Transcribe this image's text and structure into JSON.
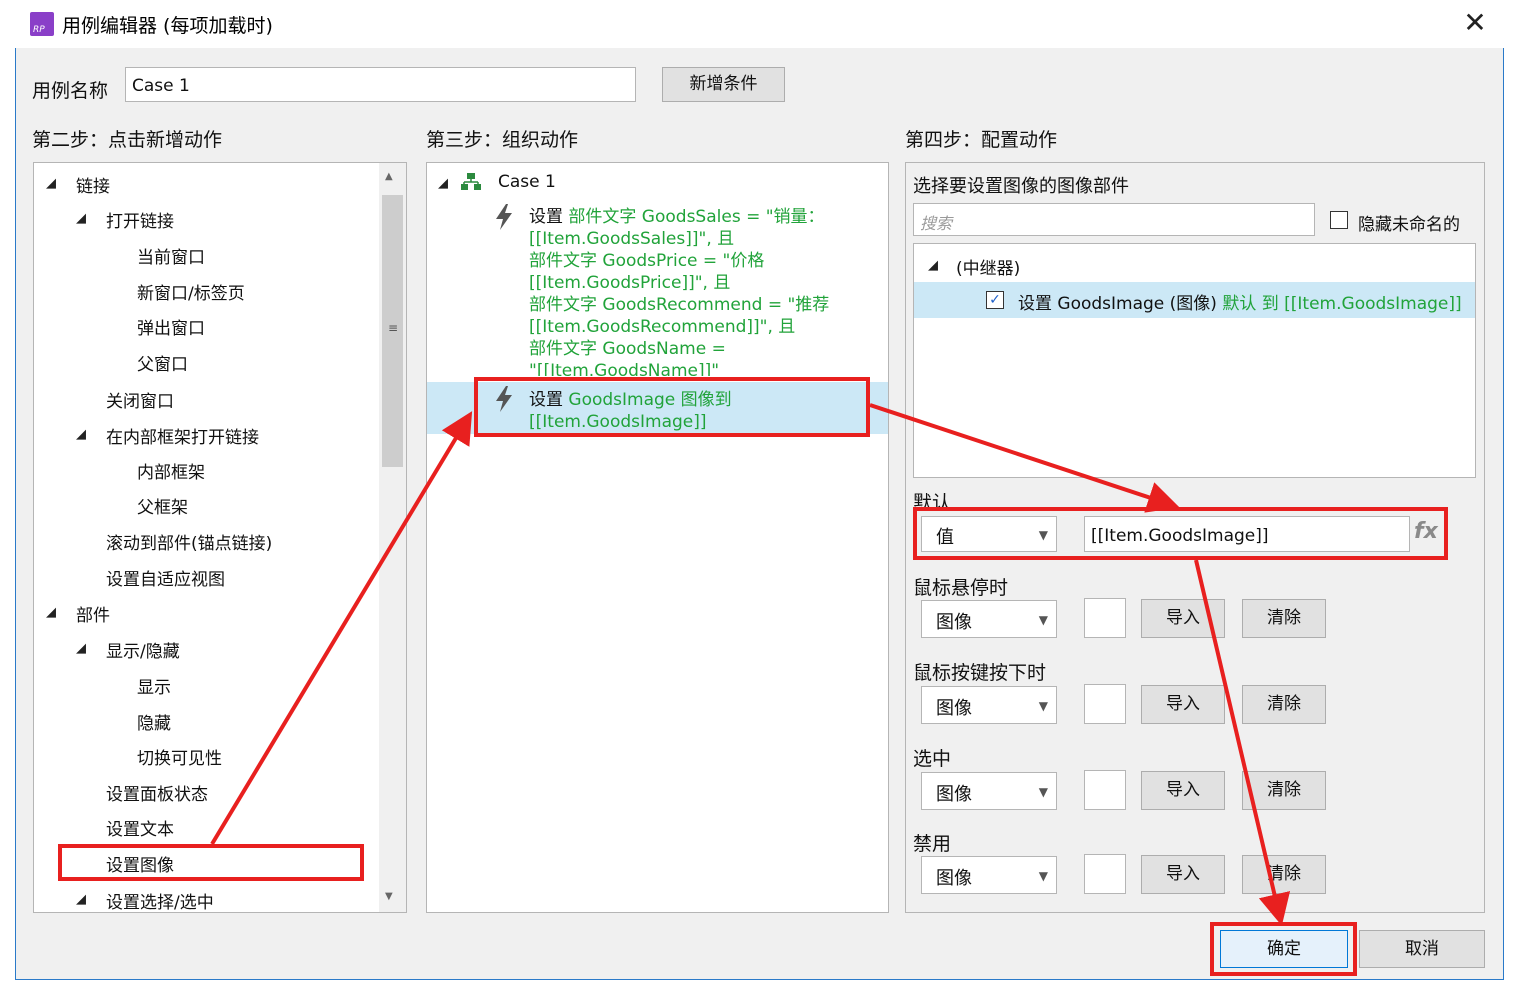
{
  "window": {
    "title": "用例编辑器 (每项加载时)"
  },
  "case_name": {
    "label": "用例名称",
    "value": "Case 1",
    "add_condition": "新增条件"
  },
  "step2": {
    "heading": "第二步：点击新增动作",
    "items": [
      "链接",
      "打开链接",
      "当前窗口",
      "新窗口/标签页",
      "弹出窗口",
      "父窗口",
      "关闭窗口",
      "在内部框架打开链接",
      "内部框架",
      "父框架",
      "滚动到部件(锚点链接)",
      "设置自适应视图",
      "部件",
      "显示/隐藏",
      "显示",
      "隐藏",
      "切换可见性",
      "设置面板状态",
      "设置文本",
      "设置图像",
      "设置选择/选中"
    ]
  },
  "step3": {
    "heading": "第三步：组织动作",
    "case": "Case 1",
    "action1": {
      "l1a": "设置",
      "l1b": "部件文字 GoodsSales = \"销量：",
      "l2": "[[Item.GoodsSales]]\", 且",
      "l3": " 部件文字 GoodsPrice = \"价格",
      "l4": "[[Item.GoodsPrice]]\", 且",
      "l5": " 部件文字 GoodsRecommend = \"推荐",
      "l6": "[[Item.GoodsRecommend]]\", 且",
      "l7": " 部件文字 GoodsName =",
      "l8": "\"[[Item.GoodsName]]\""
    },
    "action2": {
      "l1a": "设置",
      "l1b": "GoodsImage 图像到",
      "l2": "[[Item.GoodsImage]]"
    }
  },
  "step4": {
    "heading": "第四步：配置动作",
    "select_label": "选择要设置图像的图像部件",
    "search_placeholder": "搜索",
    "hide_unnamed": "隐藏未命名的",
    "tree_root": "(中继器)",
    "tree_item": {
      "a": "设置 GoodsImage (图像)",
      "b": "默认 到 [[Item.GoodsImage]]"
    },
    "default_label": "默认",
    "default_type": "值",
    "default_value": "[[Item.GoodsImage]]",
    "fx": "fx",
    "hover_label": "鼠标悬停时",
    "mousedown_label": "鼠标按键按下时",
    "selected_label": "选中",
    "disabled_label": "禁用",
    "image_type": "图像",
    "import": "导入",
    "clear": "清除"
  },
  "footer": {
    "ok": "确定",
    "cancel": "取消"
  },
  "colors": {
    "annotation": "#e8201f",
    "highlight": "#cce8f6",
    "green_text": "#21a33a"
  }
}
